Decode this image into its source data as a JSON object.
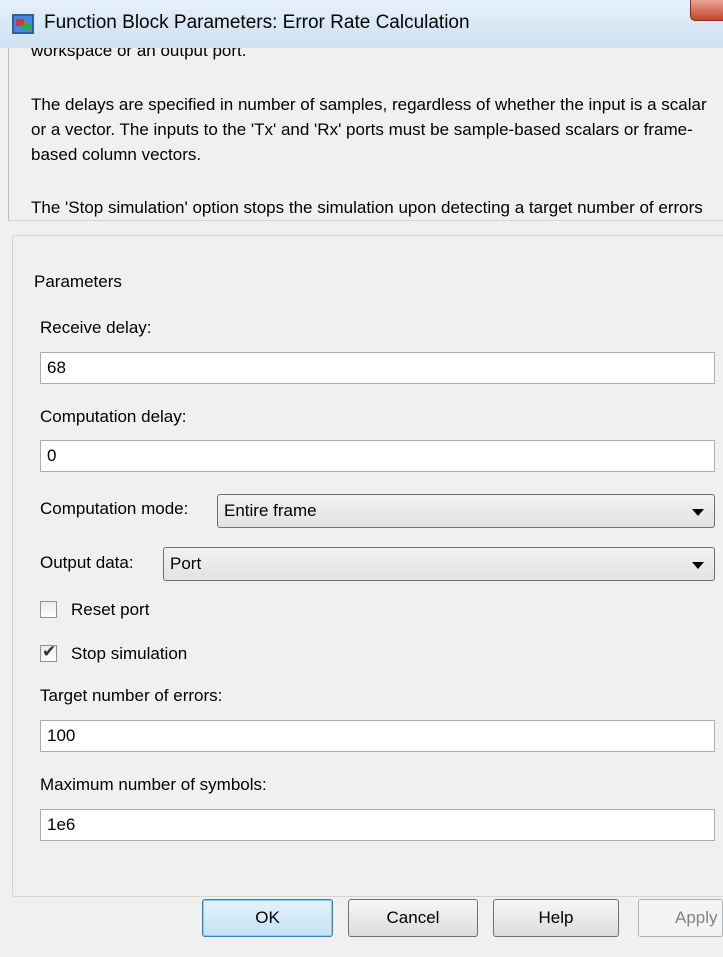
{
  "window": {
    "title": "Function Block Parameters: Error Rate Calculation"
  },
  "description": {
    "paragraphs": [
      "workspace or an output port.",
      "The delays are specified in number of samples, regardless of whether the input is a scalar or a vector. The inputs to the 'Tx' and 'Rx' ports must be sample-based scalars or frame-based column vectors.",
      "The 'Stop simulation' option stops the simulation upon detecting a target number of errors or a maximum number of symbols, whichever comes first."
    ]
  },
  "parameters": {
    "group_label": "Parameters",
    "receive_delay": {
      "label": "Receive delay:",
      "value": "68"
    },
    "computation_delay": {
      "label": "Computation delay:",
      "value": "0"
    },
    "computation_mode": {
      "label": "Computation mode:",
      "value": "Entire frame"
    },
    "output_data": {
      "label": "Output data:",
      "value": "Port"
    },
    "reset_port": {
      "label": "Reset port",
      "checked": false
    },
    "stop_simulation": {
      "label": "Stop simulation",
      "checked": true
    },
    "target_errors": {
      "label": "Target number of errors:",
      "value": "100"
    },
    "max_symbols": {
      "label": "Maximum number of symbols:",
      "value": "1e6"
    }
  },
  "buttons": {
    "ok": "OK",
    "cancel": "Cancel",
    "help": "Help",
    "apply": "Apply"
  },
  "icons": {
    "app": "simulink-block-icon",
    "check": "checkmark-icon",
    "dropdown": "chevron-down-icon",
    "close": "close-icon"
  },
  "colors": {
    "titlebar": "#d6e6f4",
    "close_button": "#c7432b",
    "ok_button_border": "#3c7fb1"
  }
}
